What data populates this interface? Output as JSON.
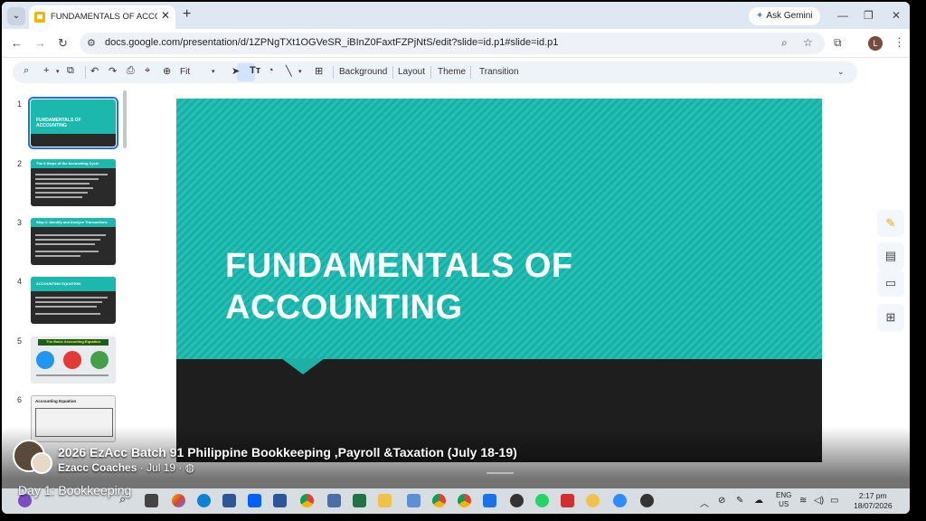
{
  "browser": {
    "tab_title": "FUNDAMENTALS OF ACCOUNTING - Google Slides",
    "tab_close": "✕",
    "new_tab": "+",
    "ask_gemini": "Ask Gemini",
    "url": "docs.google.com/presentation/d/1ZPNgTXt1OGVeSR_iBInZ0FaxtFZPjNtS/edit?slide=id.p1#slide=id.p1",
    "profile_initial": "L"
  },
  "toolbar": {
    "zoom_label": "Fit",
    "background": "Background",
    "layout": "Layout",
    "theme": "Theme",
    "transition": "Transition"
  },
  "filmstrip": {
    "slides": [
      {
        "number": "1",
        "title": "FUNDAMENTALS OF ACCOUNTING"
      },
      {
        "number": "2",
        "title": "The 6 Steps of the Accounting Cycle"
      },
      {
        "number": "3",
        "title": "Step 1: Identify and Analyze Transactions"
      },
      {
        "number": "4",
        "title": "ACCOUNTING EQUATION"
      },
      {
        "number": "5",
        "title": "The Basic Accounting Equation"
      },
      {
        "number": "6",
        "title": "Accounting Equation"
      }
    ]
  },
  "slide": {
    "title_line1": "FUNDAMENTALS OF",
    "title_line2": "ACCOUNTING"
  },
  "overlay": {
    "post_title": "2026 EzAcc Batch 91 Philippine Bookkeeping ,Payroll &Taxation (July 18-19)",
    "author": "Ezacc Coaches",
    "date": "· Jul 19 ·",
    "caption": "Day 1: Bookkeeping"
  },
  "taskbar": {
    "lang_top": "ENG",
    "lang_bottom": "US",
    "time": "2:17 pm",
    "date": "18/07/2026"
  },
  "colors": {
    "slide_teal": "#21c1b5",
    "slide_dark": "#1e1e1e",
    "selection": "#1a73e8"
  }
}
